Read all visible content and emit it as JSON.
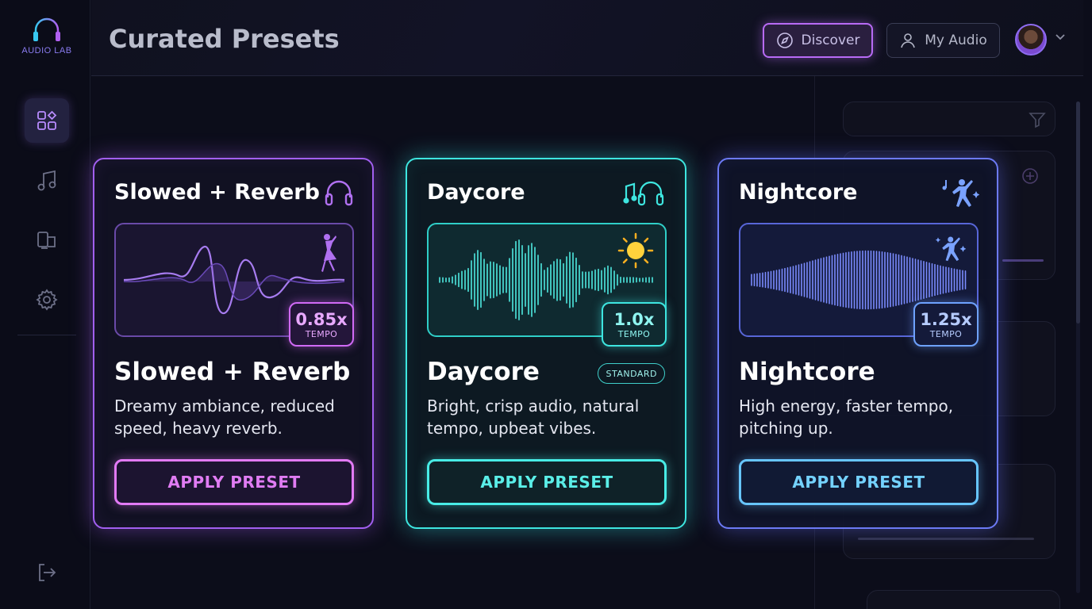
{
  "app": {
    "logo_text": "AUDIO LAB",
    "page_title": "Curated Presets"
  },
  "header": {
    "discover_label": "Discover",
    "my_audio_label": "My Audio"
  },
  "sidebar": {
    "items": [
      {
        "name": "dashboard",
        "icon": "grid-icon",
        "active": true
      },
      {
        "name": "music",
        "icon": "music-note-icon",
        "active": false
      },
      {
        "name": "devices",
        "icon": "devices-icon",
        "active": false
      },
      {
        "name": "settings",
        "icon": "gear-icon",
        "active": false
      }
    ],
    "bottom_icon": "logout-icon"
  },
  "colors": {
    "purple": "#a25ff0",
    "cyan": "#3ee6e0",
    "blue": "#6c7af5",
    "background": "#0c0d1a"
  },
  "presets": [
    {
      "header": "Slowed + Reverb",
      "title": "Slowed + Reverb",
      "tempo": "0.85x",
      "tempo_label": "TEMPO",
      "description": "Dreamy ambiance, reduced speed, heavy reverb.",
      "button": "APPLY PRESET",
      "header_icon": "headphones-icon",
      "wave_icon": "dancer-icon"
    },
    {
      "header": "Daycore",
      "title": "Daycore",
      "badge": "STANDARD",
      "tempo": "1.0x",
      "tempo_label": "TEMPO",
      "description": "Bright, crisp audio, natural tempo, upbeat vibes.",
      "button": "APPLY PRESET",
      "header_icon": "music-headphones-icon",
      "wave_icon": "sun-icon"
    },
    {
      "header": "Nightcore",
      "title": "Nightcore",
      "tempo": "1.25x",
      "tempo_label": "TEMPO",
      "description": "High energy, faster tempo, pitching up.",
      "button": "APPLY PRESET",
      "header_icon": "dancing-person-icon",
      "wave_icon": "dancing-person-icon"
    }
  ]
}
